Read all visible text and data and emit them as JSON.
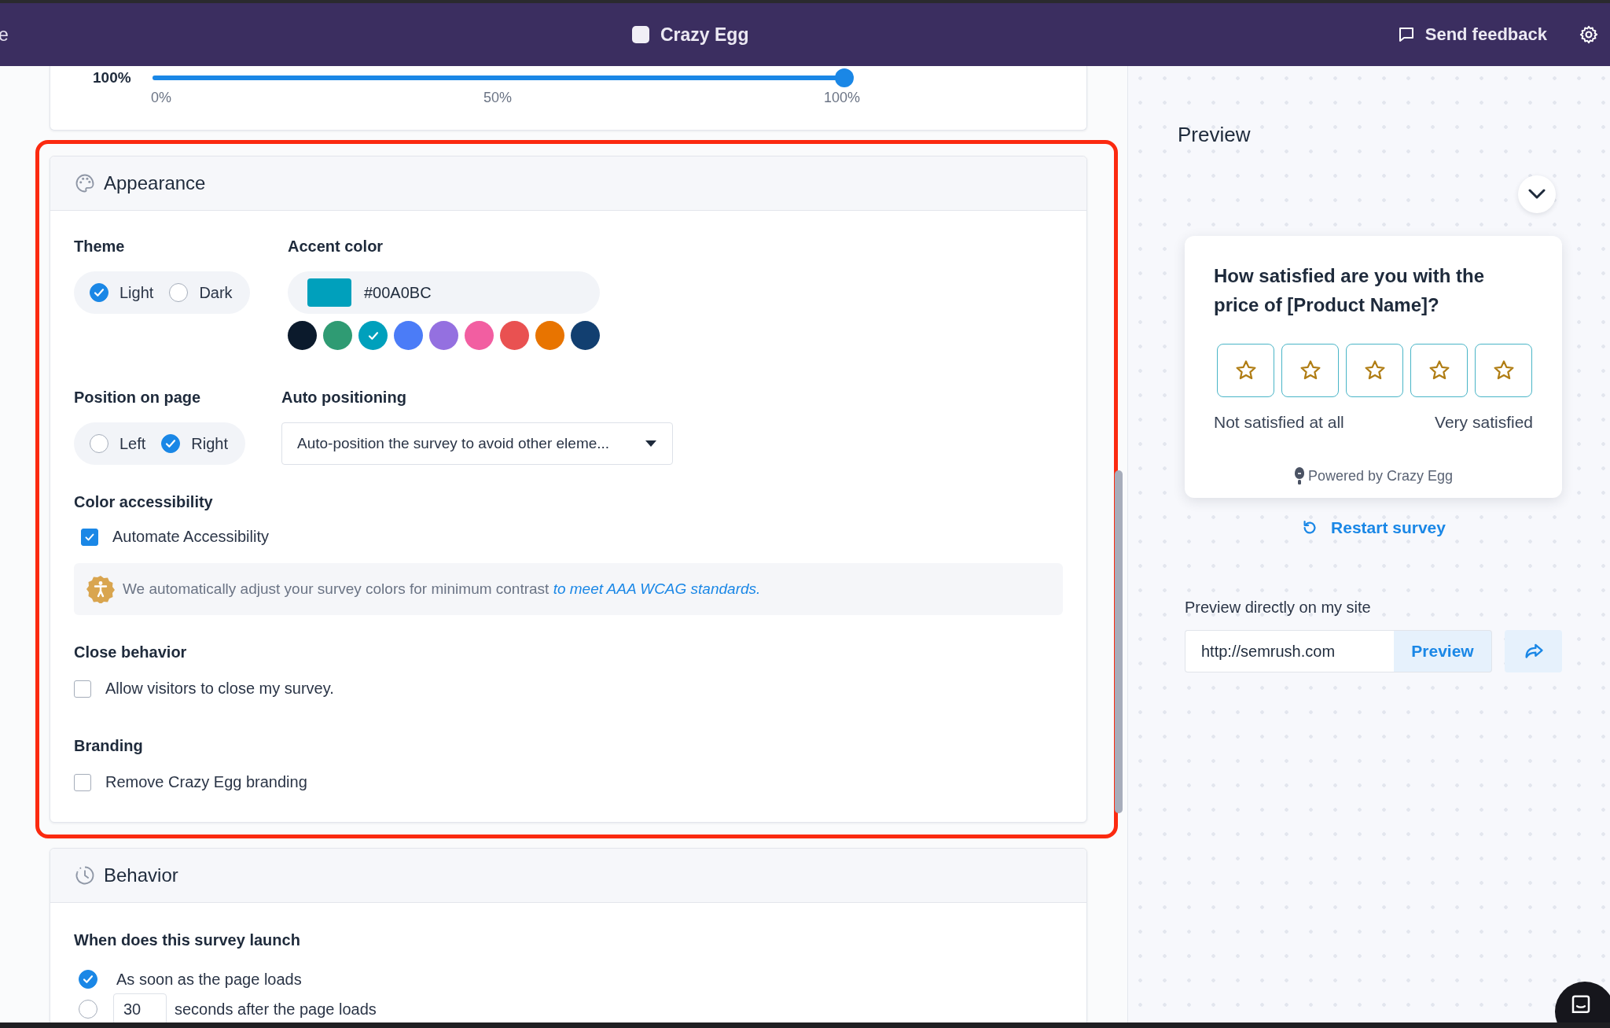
{
  "top_bar": {
    "left_text": "e",
    "title": "Crazy Egg",
    "feedback": "Send feedback"
  },
  "range": {
    "value_label": "100%",
    "level": 1,
    "ticks": [
      "0%",
      "50%",
      "100%"
    ]
  },
  "appearance": {
    "title": "Appearance",
    "highlighted": true,
    "theme": {
      "label": "Theme",
      "options": [
        {
          "label": "Light",
          "selected": true
        },
        {
          "label": "Dark",
          "selected": false
        }
      ]
    },
    "accent": {
      "label": "Accent color",
      "value": "#00A0BC",
      "color": "#00a0bc",
      "swatches": [
        {
          "color": "#0b1a2c",
          "selected": false
        },
        {
          "color": "#2f9b73",
          "selected": false
        },
        {
          "color": "#00a0bc",
          "selected": true
        },
        {
          "color": "#4b7cf7",
          "selected": false
        },
        {
          "color": "#9470e0",
          "selected": false
        },
        {
          "color": "#f25ea1",
          "selected": false
        },
        {
          "color": "#e95151",
          "selected": false
        },
        {
          "color": "#e87400",
          "selected": false
        },
        {
          "color": "#123f70",
          "selected": false
        }
      ]
    },
    "position": {
      "label": "Position on page",
      "options": [
        {
          "label": "Left",
          "selected": false
        },
        {
          "label": "Right",
          "selected": true
        }
      ]
    },
    "auto_positioning": {
      "label": "Auto positioning",
      "value": "Auto-position the survey to avoid other eleme..."
    },
    "color_accessibility": {
      "label": "Color accessibility",
      "checkbox": {
        "label": "Automate Accessibility",
        "checked": true
      },
      "notice": {
        "text": "We automatically adjust your survey colors for minimum contrast",
        "link": "to meet AAA WCAG standards."
      }
    },
    "close_behavior": {
      "label": "Close behavior",
      "checkbox": {
        "label": "Allow visitors to close my survey.",
        "checked": false
      }
    },
    "branding": {
      "label": "Branding",
      "checkbox": {
        "label": "Remove Crazy Egg branding",
        "checked": false
      }
    }
  },
  "behavior": {
    "title": "Behavior",
    "launch": {
      "label": "When does this survey launch",
      "options": [
        {
          "kind": "plain",
          "label": "As soon as the page loads",
          "selected": true
        },
        {
          "kind": "delay",
          "value": "30",
          "label": "seconds after the page loads",
          "selected": false
        }
      ]
    }
  },
  "preview": {
    "title": "Preview",
    "question": "How satisfied are you with the price of [Product Name]?",
    "rating": {
      "buttons": [
        {
          "selected": false
        },
        {
          "selected": false
        },
        {
          "selected": false
        },
        {
          "selected": false
        },
        {
          "selected": false
        }
      ]
    },
    "low_label": "Not satisfied at all",
    "high_label": "Very satisfied",
    "powered_by": "Powered by Crazy Egg",
    "restart": "Restart survey",
    "direct_label": "Preview directly on my site",
    "url": "http://semrush.com",
    "preview_button": "Preview"
  }
}
